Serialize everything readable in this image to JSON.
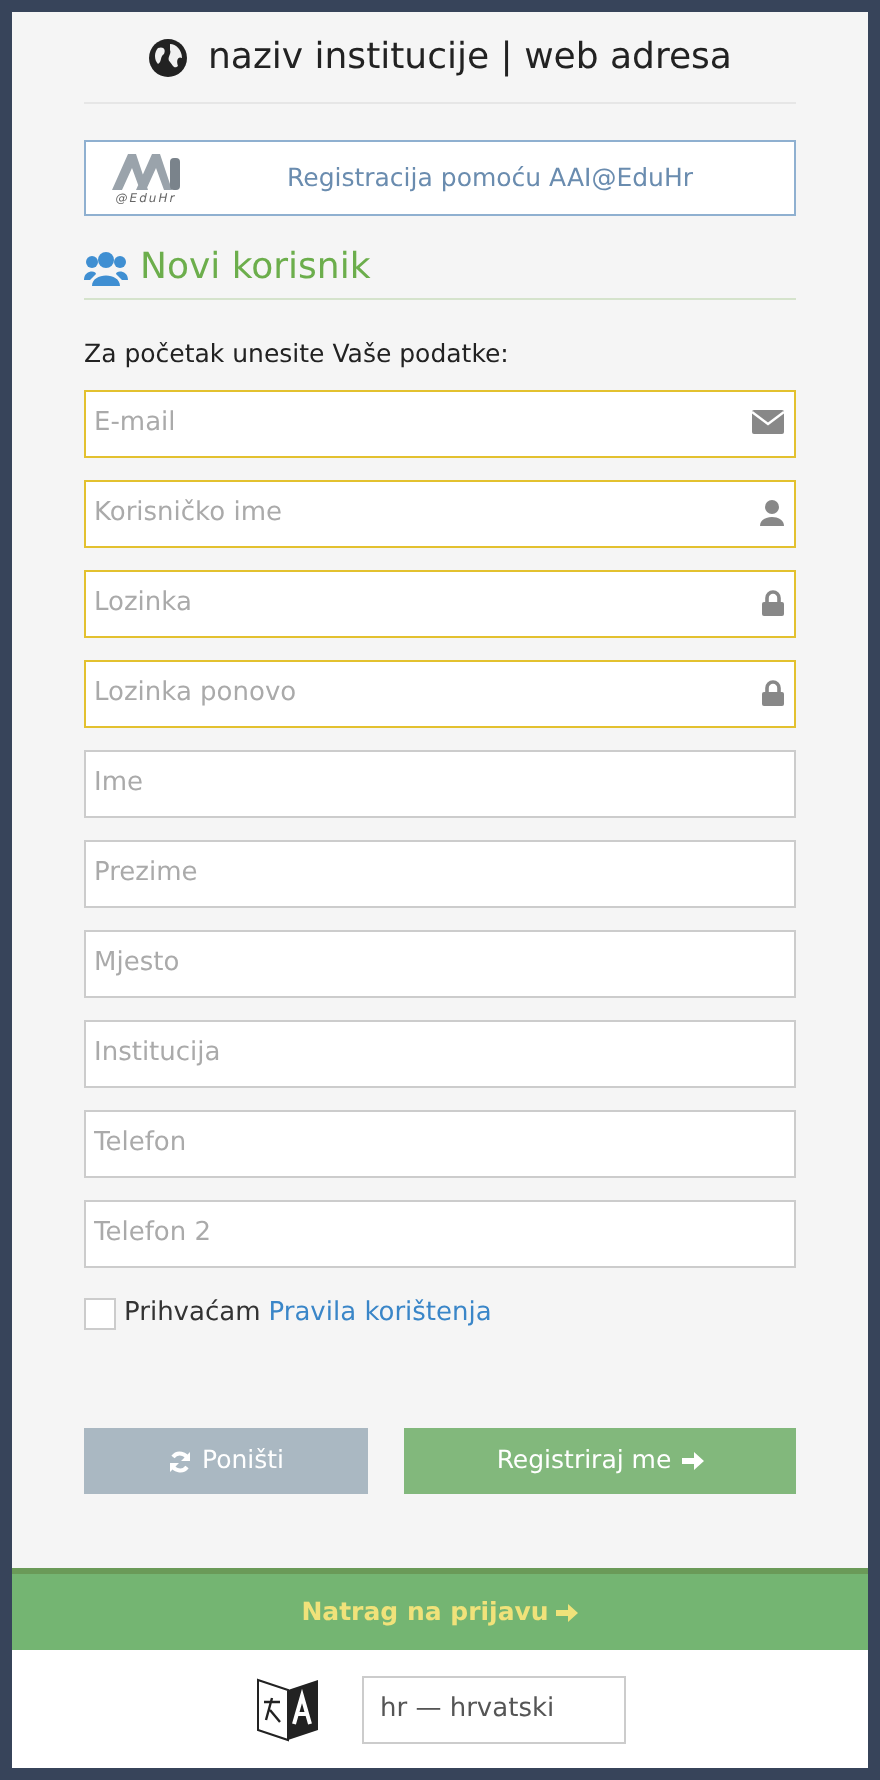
{
  "header": {
    "title": "naziv institucije | web adresa"
  },
  "aai_button": {
    "logo_caption": "@EduHr",
    "label": "Registracija pomoću AAI@EduHr"
  },
  "section": {
    "title": "Novi korisnik"
  },
  "intro": "Za početak unesite Vaše podatke:",
  "fields": [
    {
      "kind": "email",
      "placeholder": "E-mail",
      "required": true
    },
    {
      "kind": "user",
      "placeholder": "Korisničko ime",
      "required": true
    },
    {
      "kind": "password",
      "placeholder": "Lozinka",
      "required": true
    },
    {
      "kind": "password",
      "placeholder": "Lozinka ponovo",
      "required": true
    },
    {
      "kind": "plain",
      "placeholder": "Ime",
      "required": false
    },
    {
      "kind": "plain",
      "placeholder": "Prezime",
      "required": false
    },
    {
      "kind": "plain",
      "placeholder": "Mjesto",
      "required": false
    },
    {
      "kind": "plain",
      "placeholder": "Institucija",
      "required": false
    },
    {
      "kind": "plain",
      "placeholder": "Telefon",
      "required": false
    },
    {
      "kind": "plain",
      "placeholder": "Telefon 2",
      "required": false
    }
  ],
  "terms": {
    "checked": false,
    "text": "Prihvaćam",
    "link": "Pravila korištenja"
  },
  "buttons": {
    "reset": "Poništi",
    "submit": "Registriraj me"
  },
  "back_link": "Natrag na prijavu",
  "language": {
    "value": "hr — hrvatski"
  }
}
